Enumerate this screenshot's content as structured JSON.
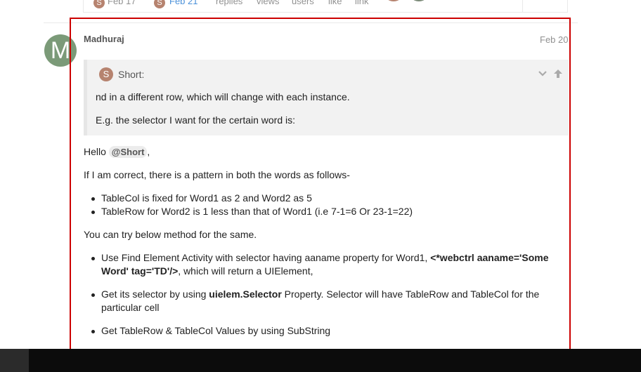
{
  "topic_stats": {
    "created_avatar": "S",
    "created_date": "Feb 17",
    "last_avatar": "S",
    "last_date": "Feb 21",
    "labels": [
      "replies",
      "views",
      "users",
      "like",
      "link"
    ],
    "colors": {
      "avatar1": "#b6836f",
      "avatar2": "#7b8a78"
    }
  },
  "post": {
    "avatar_letter": "M",
    "avatar_color": "#7b9a78",
    "username": "Madhuraj",
    "date": "Feb 20",
    "quote": {
      "avatar_letter": "S",
      "author": "Short:",
      "line1": "nd in a different row, which will change with each instance.",
      "line2": "E.g. the selector I want for the certain word is:",
      "icons": [
        "chevron-down-icon",
        "arrow-up-icon"
      ]
    },
    "greeting": "Hello",
    "mention": "@Short",
    "greeting_end": ",",
    "intro": "If I am correct, there is a pattern in both the words as follows-",
    "pattern_list": [
      "TableCol is fixed for Word1 as 2 and Word2 as 5",
      "TableRow for Word2 is 1 less than that of Word1 (i.e 7-1=6 Or 23-1=22)"
    ],
    "method_intro": "You can try below method for the same.",
    "steps": {
      "s1_pre": "Use Find Element Activity with selector having aaname property for Word1, ",
      "s1_bold": "<*webctrl aaname='Some Word' tag='TD'/>",
      "s1_post": ", which will return a UIElement,",
      "s2_pre": "Get its selector by using ",
      "s2_bold": "uielem.Selector",
      "s2_post": " Property. Selector will have TableRow and TableCol for the particular cell",
      "s3": "Get TableRow & TableCol Values by using SubString"
    }
  },
  "colors": {
    "highlight_frame": "#cc0000",
    "quote_bg": "#f2f2f2"
  }
}
